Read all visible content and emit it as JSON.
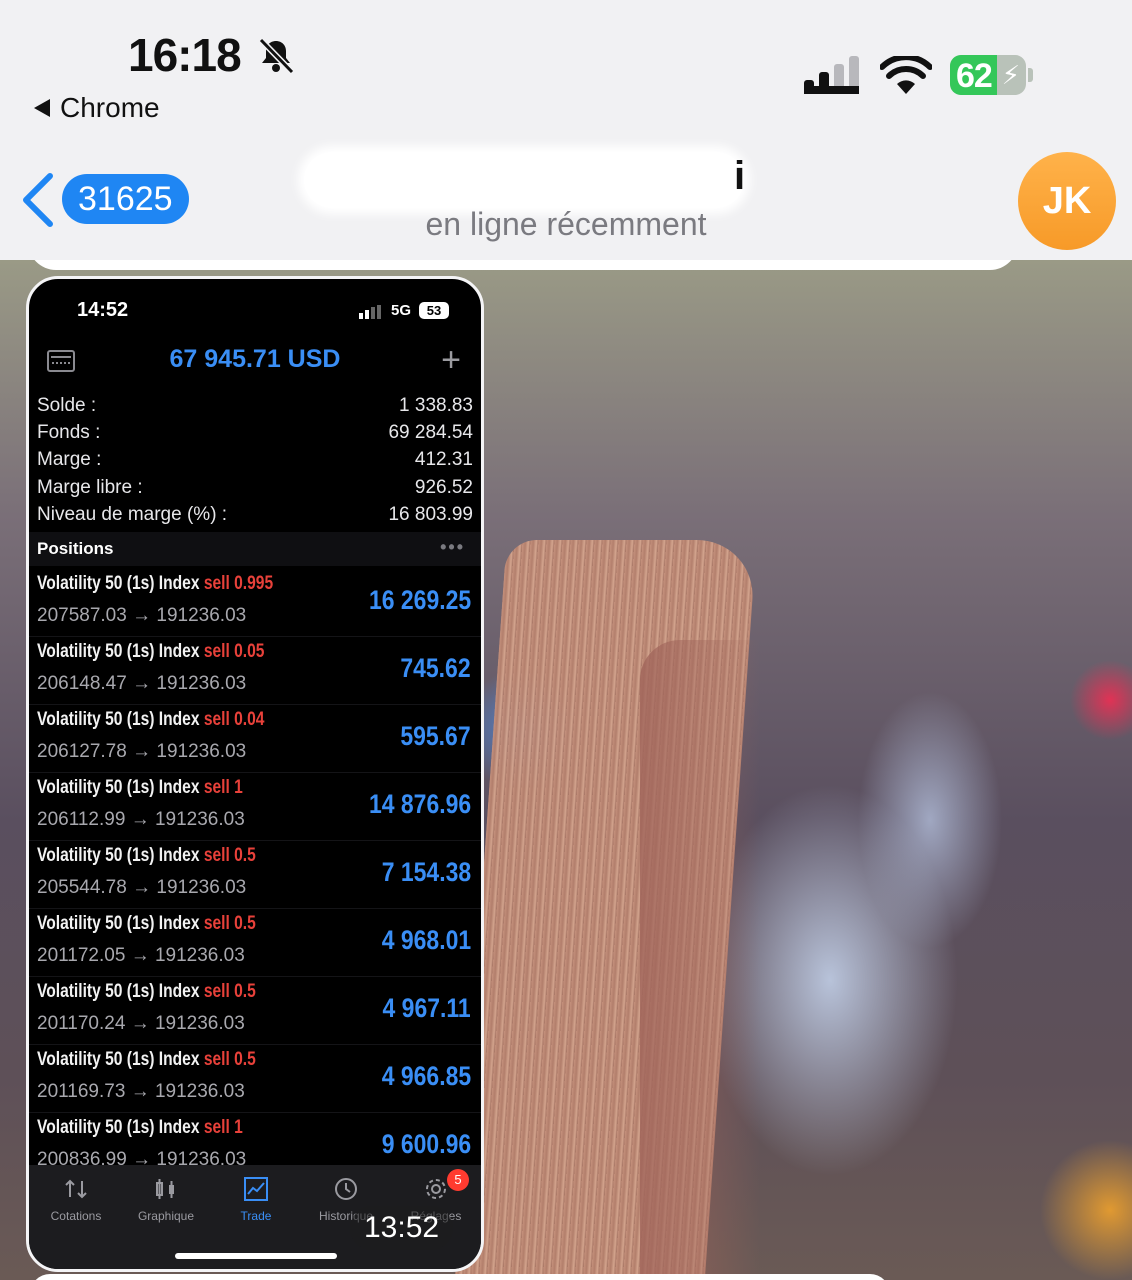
{
  "status_bar": {
    "time": "16:18",
    "back_app": "Chrome",
    "battery_percent": "62",
    "battery_level": 0.62
  },
  "chat_header": {
    "unread_count": "31625",
    "contact_name_visible": "i",
    "contact_status": "en ligne récemment",
    "avatar_initials": "JK"
  },
  "screenshot": {
    "status": {
      "time": "14:52",
      "network": "5G",
      "battery": "53"
    },
    "total_equity": "67 945.71 USD",
    "summary": [
      {
        "label": "Solde :",
        "value": "1 338.83"
      },
      {
        "label": "Fonds :",
        "value": "69 284.54"
      },
      {
        "label": "Marge :",
        "value": "412.31"
      },
      {
        "label": "Marge libre :",
        "value": "926.52"
      },
      {
        "label": "Niveau de marge (%) :",
        "value": "16 803.99"
      }
    ],
    "positions_title": "Positions",
    "positions": [
      {
        "symbol": "Volatility 50 (1s) Index",
        "side": "sell",
        "volume": "0.995",
        "open": "207587.03",
        "current": "191236.03",
        "profit": "16 269.25"
      },
      {
        "symbol": "Volatility 50 (1s) Index",
        "side": "sell",
        "volume": "0.05",
        "open": "206148.47",
        "current": "191236.03",
        "profit": "745.62"
      },
      {
        "symbol": "Volatility 50 (1s) Index",
        "side": "sell",
        "volume": "0.04",
        "open": "206127.78",
        "current": "191236.03",
        "profit": "595.67"
      },
      {
        "symbol": "Volatility 50 (1s) Index",
        "side": "sell",
        "volume": "1",
        "open": "206112.99",
        "current": "191236.03",
        "profit": "14 876.96"
      },
      {
        "symbol": "Volatility 50 (1s) Index",
        "side": "sell",
        "volume": "0.5",
        "open": "205544.78",
        "current": "191236.03",
        "profit": "7 154.38"
      },
      {
        "symbol": "Volatility 50 (1s) Index",
        "side": "sell",
        "volume": "0.5",
        "open": "201172.05",
        "current": "191236.03",
        "profit": "4 968.01"
      },
      {
        "symbol": "Volatility 50 (1s) Index",
        "side": "sell",
        "volume": "0.5",
        "open": "201170.24",
        "current": "191236.03",
        "profit": "4 967.11"
      },
      {
        "symbol": "Volatility 50 (1s) Index",
        "side": "sell",
        "volume": "0.5",
        "open": "201169.73",
        "current": "191236.03",
        "profit": "4 966.85"
      },
      {
        "symbol": "Volatility 50 (1s) Index",
        "side": "sell",
        "volume": "1",
        "open": "200836.99",
        "current": "191236.03",
        "profit": "9 600.96"
      }
    ],
    "tabs": [
      {
        "label": "Cotations",
        "icon": "quotes-icon",
        "active": false
      },
      {
        "label": "Graphique",
        "icon": "candles-icon",
        "active": false
      },
      {
        "label": "Trade",
        "icon": "trade-chart-icon",
        "active": true
      },
      {
        "label": "Historique",
        "icon": "history-icon",
        "active": false
      },
      {
        "label": "Réglages",
        "icon": "settings-gear-icon",
        "active": false
      }
    ],
    "settings_badge": "5"
  },
  "message_time": "13:52",
  "colors": {
    "accent_blue": "#1f86f3",
    "trade_blue": "#3a8ef5",
    "sell_red": "#e8413a",
    "avatar_orange": "#f79a28",
    "battery_green": "#34c759"
  }
}
